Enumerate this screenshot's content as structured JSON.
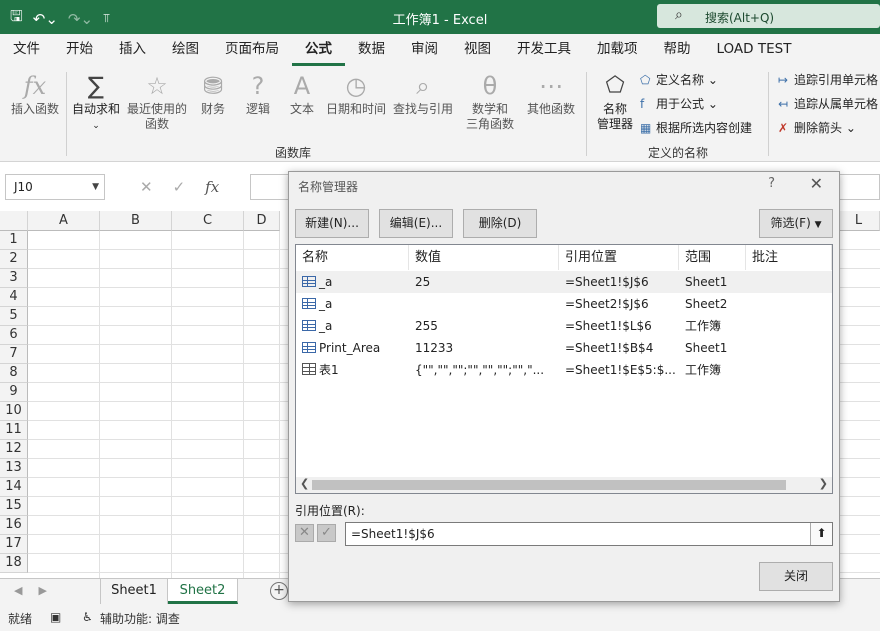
{
  "titlebar": {
    "title": "工作簿1  -  Excel",
    "search_placeholder": "搜索(Alt+Q)"
  },
  "tabs": [
    "文件",
    "开始",
    "插入",
    "绘图",
    "页面布局",
    "公式",
    "数据",
    "审阅",
    "视图",
    "开发工具",
    "加载项",
    "帮助",
    "LOAD TEST"
  ],
  "active_tab": "公式",
  "ribbon": {
    "insert_function": "插入函数",
    "autosum": "自动求和",
    "recent_line1": "最近使用的",
    "recent_line2": "函数",
    "financial": "财务",
    "logical": "逻辑",
    "text": "文本",
    "datetime": "日期和时间",
    "lookup": "查找与引用",
    "math_line1": "数学和",
    "math_line2": "三角函数",
    "other": "其他函数",
    "function_library": "函数库",
    "name_manager_line1": "名称",
    "name_manager_line2": "管理器",
    "define_name": "定义名称",
    "use_in_formula": "用于公式",
    "create_from_selection": "根据所选内容创建",
    "defined_names": "定义的名称",
    "trace_precedents": "追踪引用单元格",
    "trace_dependents": "追踪从属单元格",
    "remove_arrows": "删除箭头"
  },
  "formula_bar": {
    "name_box": "J10"
  },
  "grid": {
    "columns": [
      "A",
      "B",
      "C",
      "D",
      "L"
    ],
    "rows": [
      "1",
      "2",
      "3",
      "4",
      "5",
      "6",
      "7",
      "8",
      "9",
      "10",
      "11",
      "12",
      "13",
      "14",
      "15",
      "16",
      "17",
      "18"
    ]
  },
  "sheets": [
    "Sheet1",
    "Sheet2"
  ],
  "active_sheet": "Sheet2",
  "status": {
    "ready": "就绪",
    "accessibility": "辅助功能: 调查"
  },
  "dialog": {
    "title": "名称管理器",
    "help": "?",
    "new_button": "新建(N)...",
    "edit_button": "编辑(E)...",
    "delete_button": "删除(D)",
    "filter_button": "筛选(F)",
    "columns": [
      "名称",
      "数值",
      "引用位置",
      "范围",
      "批注"
    ],
    "rows": [
      {
        "icon": "name",
        "name": "_a",
        "value": "25",
        "refers_to": "=Sheet1!$J$6",
        "scope": "Sheet1",
        "comment": ""
      },
      {
        "icon": "name",
        "name": "_a",
        "value": "",
        "refers_to": "=Sheet2!$J$6",
        "scope": "Sheet2",
        "comment": ""
      },
      {
        "icon": "name",
        "name": "_a",
        "value": "255",
        "refers_to": "=Sheet1!$L$6",
        "scope": "工作簿",
        "comment": ""
      },
      {
        "icon": "name",
        "name": "Print_Area",
        "value": "11233",
        "refers_to": "=Sheet1!$B$4",
        "scope": "Sheet1",
        "comment": ""
      },
      {
        "icon": "table",
        "name": "表1",
        "value": "{\"\",\"\",\"\";\"\",\"\",\"\";\"\",\"...",
        "refers_to": "=Sheet1!$E$5:$...",
        "scope": "工作簿",
        "comment": ""
      }
    ],
    "refers_to_label": "引用位置(R):",
    "refers_to_value": "=Sheet1!$J$6",
    "close_button": "关闭"
  },
  "colors": {
    "brand": "#217346",
    "selection_row": "#f0f0f0"
  }
}
